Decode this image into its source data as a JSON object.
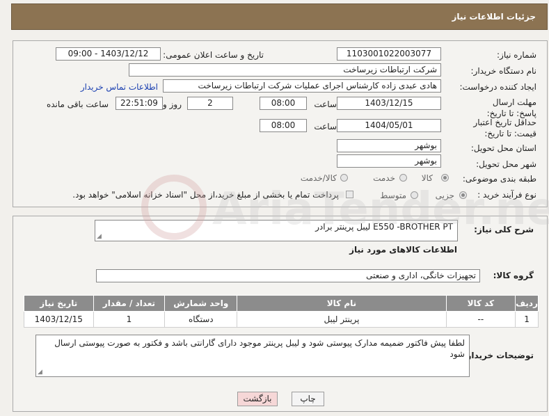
{
  "header": {
    "title": "جزئیات اطلاعات نیاز"
  },
  "form": {
    "need_number_label": "شماره نیاز:",
    "need_number": "1103001022003077",
    "announce_label": "تاریخ و ساعت اعلان عمومی:",
    "announce_value": "1403/12/12 - 09:00",
    "buyer_org_label": "نام دستگاه خریدار:",
    "buyer_org": "شرکت ارتباطات زیرساخت",
    "creator_label": "ایجاد کننده درخواست:",
    "creator": "هادی عبدی زاده کارشناس اجرای عملیات شرکت ارتباطات زیرساخت",
    "contact_link": "اطلاعات تماس خریدار",
    "deadline_label": "مهلت ارسال پاسخ: تا تاریخ:",
    "deadline_date": "1403/12/15",
    "time_label": "ساعت",
    "deadline_time": "08:00",
    "days_value": "2",
    "days_label": "روز و",
    "remaining_time": "22:51:09",
    "remaining_label": "ساعت باقی مانده",
    "validity_label": "حداقل تاریخ اعتبار قیمت: تا تاریخ:",
    "validity_date": "1404/05/01",
    "validity_time": "08:00",
    "province_label": "استان محل تحویل:",
    "province": "بوشهر",
    "city_label": "شهر محل تحویل:",
    "city": "بوشهر",
    "category_label": "طبقه بندی موضوعی:",
    "category_options": [
      "کالا",
      "خدمت",
      "کالا/خدمت"
    ],
    "process_label": "نوع فرآیند خرید :",
    "process_options": [
      "جزیی",
      "متوسط"
    ],
    "payment_note": "پرداخت تمام یا بخشی از مبلغ خرید،از محل \"اسناد خزانه اسلامی\" خواهد بود."
  },
  "summary": {
    "label": "شرح کلی نیاز:",
    "value": "لیبل پرینتر برادر E550 -BROTHER PT",
    "goods_info_title": "اطلاعات کالاهای مورد نیاز",
    "group_label": "گروه کالا:",
    "group_value": "تجهیزات خانگی، اداری و صنعتی"
  },
  "table": {
    "headers": [
      "ردیف",
      "کد کالا",
      "نام کالا",
      "واحد شمارش",
      "تعداد / مقدار",
      "تاریخ نیاز"
    ],
    "rows": [
      [
        "1",
        "--",
        "پرینتر لیبل",
        "دستگاه",
        "1",
        "1403/12/15"
      ]
    ]
  },
  "notes": {
    "label": "توضیحات خریدار:",
    "text": "لطفا پیش فاکتور ضمیمه مدارک پیوستی شود و لیبل پرینتر موجود دارای گارانتی باشد و فکتور به صورت پیوستی ارسال شود"
  },
  "buttons": {
    "print": "چاپ",
    "back": "بازگشت"
  },
  "watermark": {
    "text": "AriaTender.neT"
  },
  "colors": {
    "header": "#8c7352",
    "table_header": "#8c8c8c",
    "link": "#1a3fb0",
    "back_button": "#f6d7d7"
  }
}
